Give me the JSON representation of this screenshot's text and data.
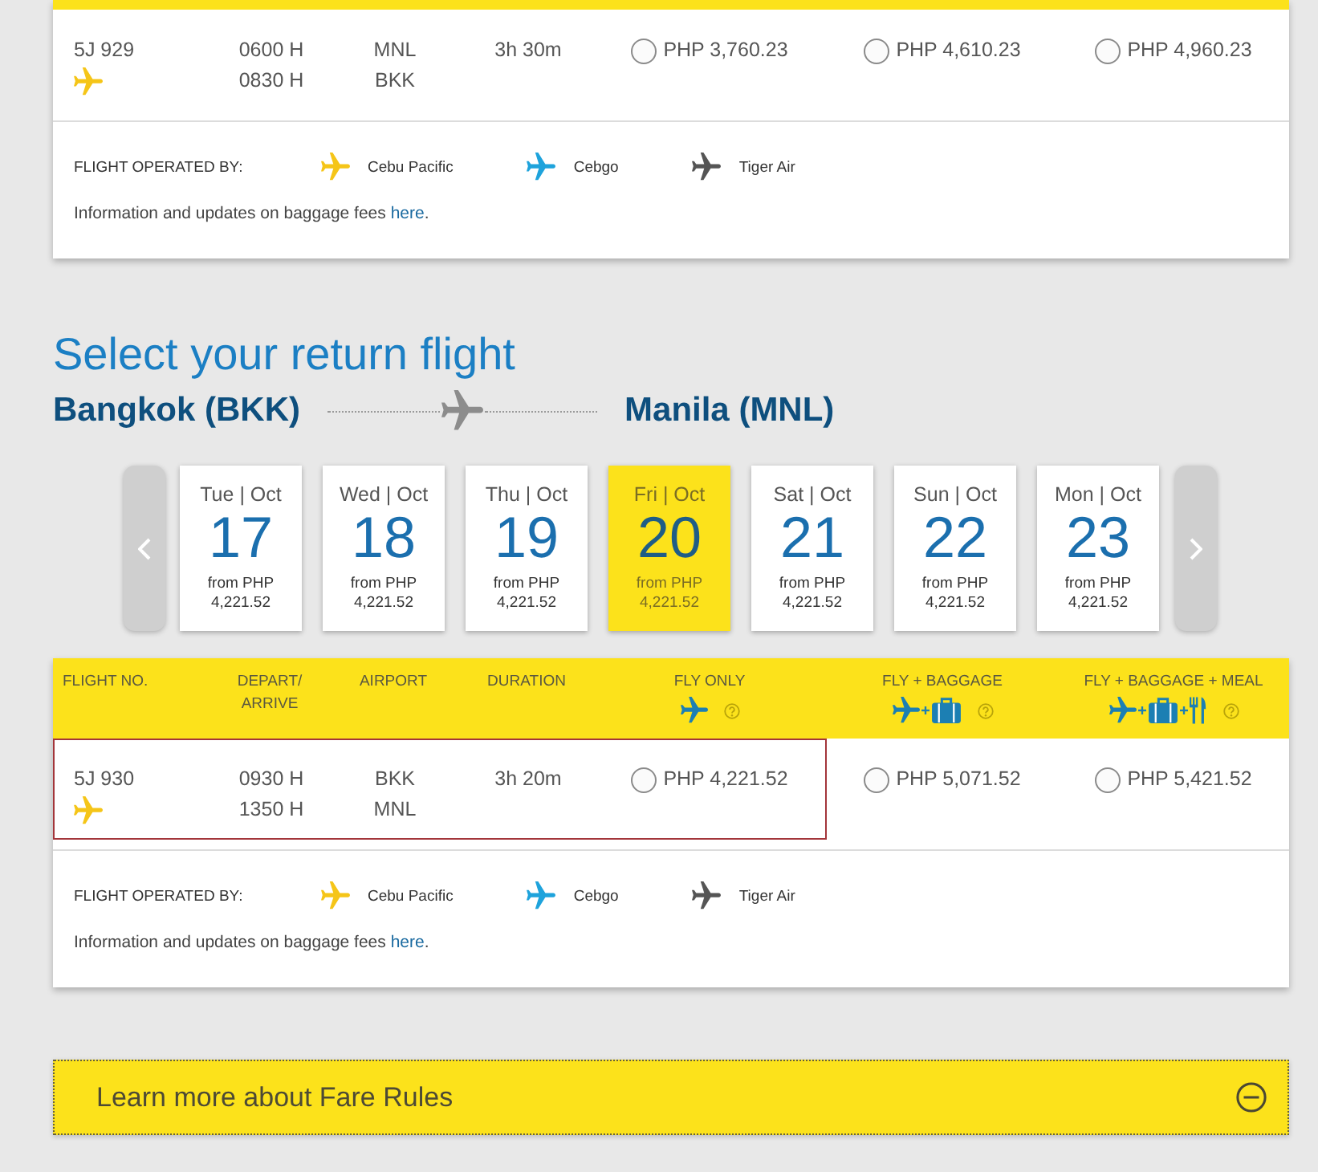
{
  "outbound_flights": {
    "rows": [
      {
        "flight_no": "5J 929",
        "depart": "0600 H",
        "arrive": "0830 H",
        "origin": "MNL",
        "destination": "BKK",
        "duration": "3h 30m",
        "outlined": false,
        "fares": [
          {
            "price": "PHP 3,760.23",
            "selected": false
          },
          {
            "price": "PHP 4,610.23",
            "selected": false
          },
          {
            "price": "PHP 4,960.23",
            "selected": false
          }
        ]
      }
    ],
    "operated_by": {
      "label": "FLIGHT OPERATED BY:",
      "carriers": [
        {
          "name": "Cebu Pacific",
          "color": "#f5c518"
        },
        {
          "name": "Cebgo",
          "color": "#1ea3dc"
        },
        {
          "name": "Tiger Air",
          "color": "#555555"
        }
      ]
    },
    "baggage_note": {
      "text": "Information and updates on baggage fees",
      "link": "here",
      "end": "."
    }
  },
  "return_section": {
    "title": "Select your return flight",
    "origin": "Bangkok (BKK)",
    "destination": "Manila (MNL)"
  },
  "dates": [
    {
      "day": "Tue | Oct",
      "date": "17",
      "from_label": "from PHP",
      "price": "4,221.52",
      "selected": false
    },
    {
      "day": "Wed | Oct",
      "date": "18",
      "from_label": "from PHP",
      "price": "4,221.52",
      "selected": false
    },
    {
      "day": "Thu | Oct",
      "date": "19",
      "from_label": "from PHP",
      "price": "4,221.52",
      "selected": false
    },
    {
      "day": "Fri | Oct",
      "date": "20",
      "from_label": "from PHP",
      "price": "4,221.52",
      "selected": true
    },
    {
      "day": "Sat | Oct",
      "date": "21",
      "from_label": "from PHP",
      "price": "4,221.52",
      "selected": false
    },
    {
      "day": "Sun | Oct",
      "date": "22",
      "from_label": "from PHP",
      "price": "4,221.52",
      "selected": false
    },
    {
      "day": "Mon | Oct",
      "date": "23",
      "from_label": "from PHP",
      "price": "4,221.52",
      "selected": false
    }
  ],
  "return_flights": {
    "columns": [
      {
        "label": "FLIGHT NO.",
        "kind": "text"
      },
      {
        "label": "DEPART/ ARRIVE",
        "kind": "text"
      },
      {
        "label": "AIRPORT",
        "kind": "text"
      },
      {
        "label": "DURATION",
        "kind": "text"
      },
      {
        "label": "FLY ONLY",
        "kind": "fly"
      },
      {
        "label": "FLY + BAGGAGE",
        "kind": "fly_baggage"
      },
      {
        "label": "FLY + BAGGAGE + MEAL",
        "kind": "fly_baggage_meal"
      }
    ],
    "rows": [
      {
        "flight_no": "5J 930",
        "depart": "0930 H",
        "arrive": "1350 H",
        "origin": "BKK",
        "destination": "MNL",
        "duration": "3h 20m",
        "outlined": true,
        "fares": [
          {
            "price": "PHP 4,221.52",
            "selected": false
          },
          {
            "price": "PHP 5,071.52",
            "selected": false
          },
          {
            "price": "PHP 5,421.52",
            "selected": false
          }
        ]
      }
    ],
    "operated_by": {
      "label": "FLIGHT OPERATED BY:",
      "carriers": [
        {
          "name": "Cebu Pacific",
          "color": "#f5c518"
        },
        {
          "name": "Cebgo",
          "color": "#1ea3dc"
        },
        {
          "name": "Tiger Air",
          "color": "#555555"
        }
      ]
    },
    "baggage_note": {
      "text": "Information and updates on baggage fees",
      "link": "here",
      "end": "."
    }
  },
  "fare_rules": {
    "label": "Learn more about Fare Rules",
    "expanded": true
  }
}
